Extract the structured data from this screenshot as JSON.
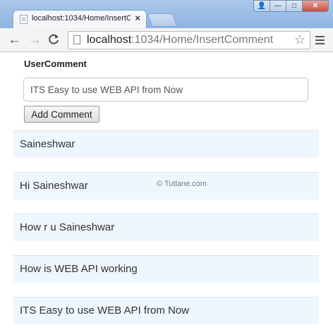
{
  "browser": {
    "tab_title": "localhost:1034/Home/InsertComment",
    "tab_close": "×",
    "window_buttons": {
      "user": "👤",
      "minimize": "—",
      "maximize": "□",
      "close": "✕"
    },
    "nav": {
      "back": "←",
      "forward": "→",
      "reload": "C"
    },
    "url_host": "localhost",
    "url_path": ":1034/Home/InsertComment",
    "bookmark_star": "☆"
  },
  "form": {
    "label": "UserComment",
    "input_value": "ITS Easy to use WEB API from Now",
    "submit_label": "Add Comment"
  },
  "comments": [
    "Saineshwar",
    "Hi Saineshwar",
    "How r u Saineshwar",
    "How is WEB API working",
    "ITS Easy to use WEB API from Now"
  ],
  "watermark": "© Tutlane.com"
}
